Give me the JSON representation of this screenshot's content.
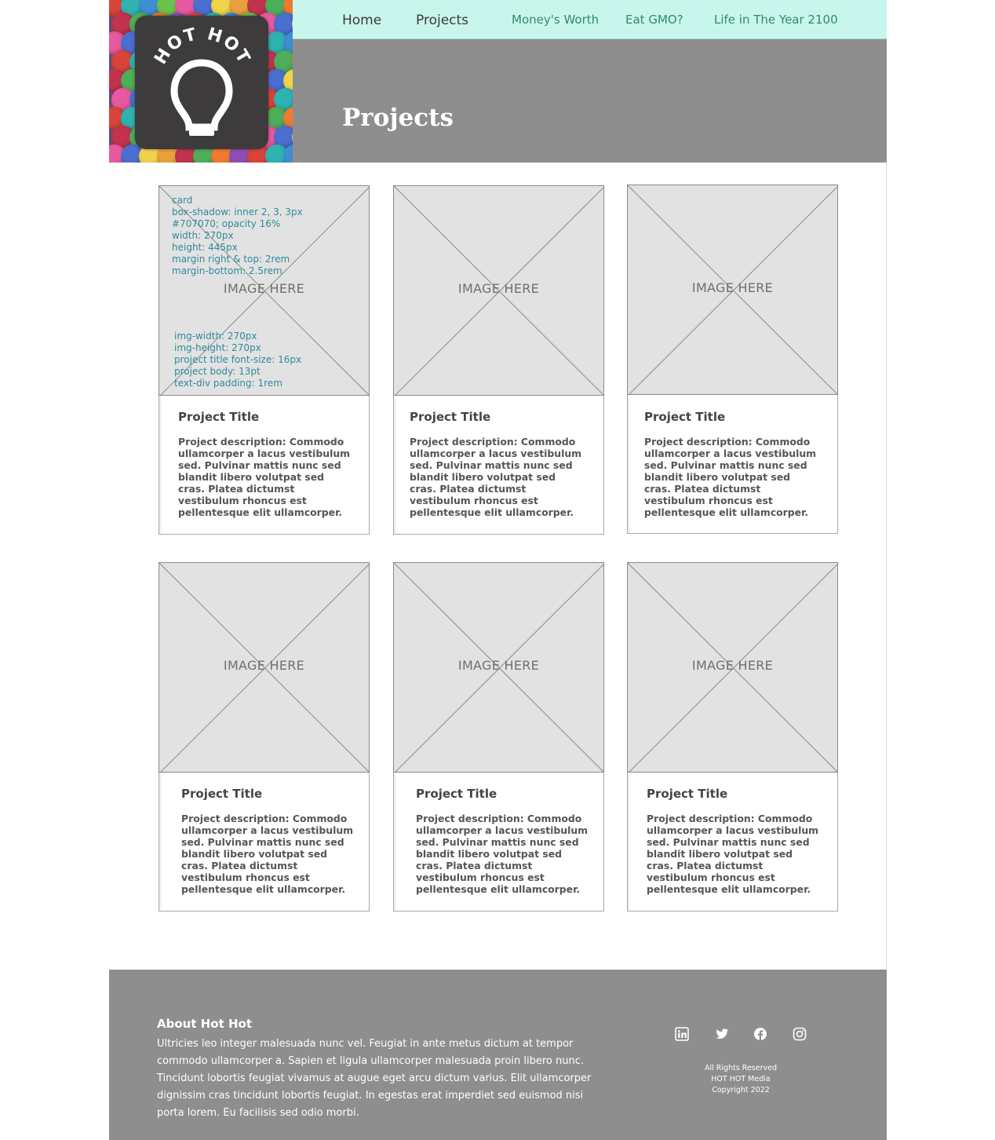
{
  "brand": {
    "logo_text": "HOT HOT",
    "logo_icon": "lightbulb-icon"
  },
  "nav": {
    "home": "Home",
    "projects": "Projects",
    "links": [
      "Money's Worth",
      "Eat GMO?",
      "Life in The Year 2100"
    ]
  },
  "hero": {
    "title": "Projects"
  },
  "cards": [
    {
      "image_label": "IMAGE HERE",
      "title": "Project Title",
      "description": "Project description: Commodo ullamcorper a lacus vestibulum sed. Pulvinar mattis nunc sed blandit libero volutpat sed cras. Platea dictumst vestibulum rhoncus est pellentesque elit ullamcorper."
    },
    {
      "image_label": "IMAGE HERE",
      "title": "Project Title",
      "description": "Project description: Commodo ullamcorper a lacus vestibulum sed. Pulvinar mattis nunc sed blandit libero volutpat sed cras. Platea dictumst vestibulum rhoncus est pellentesque elit ullamcorper."
    },
    {
      "image_label": "IMAGE HERE",
      "title": "Project Title",
      "description": "Project description: Commodo ullamcorper a lacus vestibulum sed. Pulvinar mattis nunc sed blandit libero volutpat sed cras. Platea dictumst vestibulum rhoncus est pellentesque elit ullamcorper."
    },
    {
      "image_label": "IMAGE HERE",
      "title": "Project Title",
      "description": "Project description: Commodo ullamcorper a lacus vestibulum sed. Pulvinar mattis nunc sed blandit libero volutpat sed cras. Platea dictumst vestibulum rhoncus est pellentesque elit ullamcorper."
    },
    {
      "image_label": "IMAGE HERE",
      "title": "Project Title",
      "description": "Project description: Commodo ullamcorper a lacus vestibulum sed. Pulvinar mattis nunc sed blandit libero volutpat sed cras. Platea dictumst vestibulum rhoncus est pellentesque elit ullamcorper."
    },
    {
      "image_label": "IMAGE HERE",
      "title": "Project Title",
      "description": "Project description: Commodo ullamcorper a lacus vestibulum sed. Pulvinar mattis nunc sed blandit libero volutpat sed cras. Platea dictumst vestibulum rhoncus est pellentesque elit ullamcorper."
    }
  ],
  "annotations": {
    "card_spec": [
      "card",
      "box-shadow: inner  2, 3, 3px",
      "#707070; opacity 16%",
      "width: 270px",
      "height: 445px",
      "margin right & top: 2rem",
      "margin-bottom: 2.5rem"
    ],
    "img_spec": [
      "img-width: 270px",
      "img-height: 270px",
      "project title font-size: 16px",
      "project body: 13pt",
      "text-div padding: 1rem"
    ]
  },
  "footer": {
    "about_title": "About Hot Hot",
    "about_body": "Ultricies leo integer malesuada nunc vel. Feugiat in ante metus dictum at tempor commodo ullamcorper a. Sapien et ligula ullamcorper malesuada proin libero nunc. Tincidunt lobortis feugiat vivamus at augue eget arcu dictum varius. Elit ullamcorper dignissim cras tincidunt lobortis feugiat. In egestas erat imperdiet sed euismod nisi porta lorem. Eu facilisis sed odio morbi.",
    "social_icons": [
      "linkedin-icon",
      "twitter-icon",
      "facebook-icon",
      "instagram-icon"
    ],
    "legal": [
      "All Rights Reserved",
      "HOT HOT Media",
      "Copyright 2022"
    ]
  },
  "colors": {
    "nav_bg": "#c9f6ec",
    "nav_link": "#2f8a70",
    "hero_bg": "#8e8e8e",
    "annotation": "#2e8a9b",
    "logo_box": "#3d3b3c"
  }
}
